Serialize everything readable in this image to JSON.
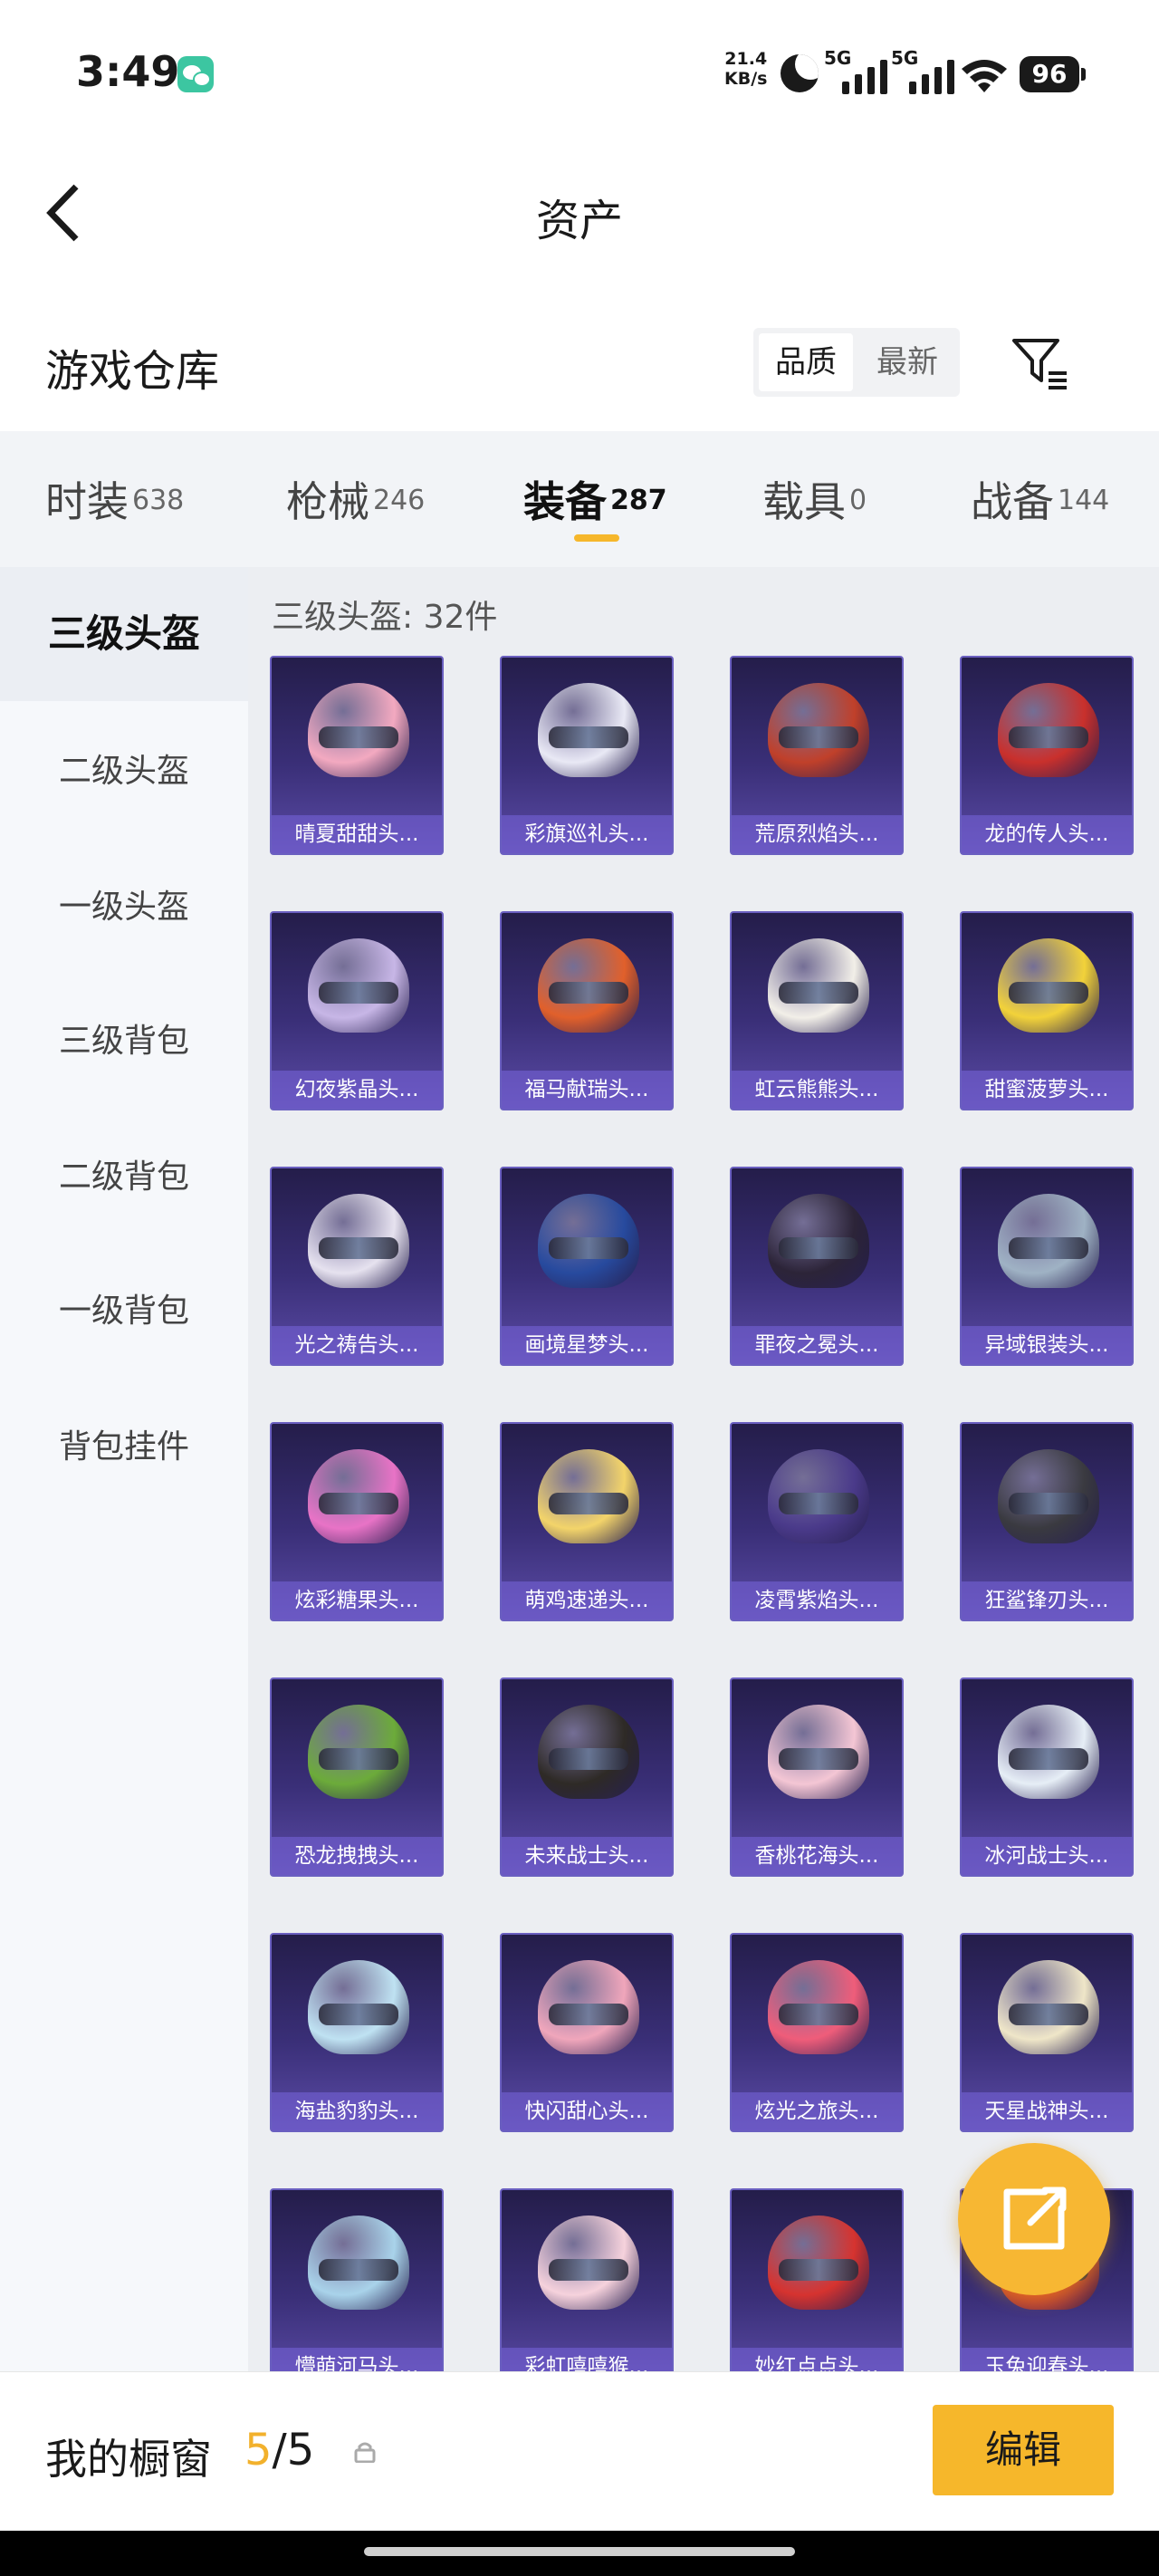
{
  "status": {
    "time": "3:49",
    "net_speed_value": "21.4",
    "net_speed_unit": "KB/s",
    "sim1": "5G",
    "sim2": "5G",
    "battery": "96"
  },
  "header": {
    "title": "资产"
  },
  "warehouse": {
    "title": "游戏仓库",
    "sort_options": [
      "品质",
      "最新"
    ],
    "sort_selected": "品质"
  },
  "tabs": [
    {
      "label": "时装",
      "count": "638"
    },
    {
      "label": "枪械",
      "count": "246"
    },
    {
      "label": "装备",
      "count": "287"
    },
    {
      "label": "载具",
      "count": "0"
    },
    {
      "label": "战备",
      "count": "144"
    }
  ],
  "active_tab": "装备",
  "sidenav": [
    {
      "label": "三级头盔"
    },
    {
      "label": "二级头盔"
    },
    {
      "label": "一级头盔"
    },
    {
      "label": "三级背包"
    },
    {
      "label": "二级背包"
    },
    {
      "label": "一级背包"
    },
    {
      "label": "背包挂件"
    }
  ],
  "grid": {
    "heading": "三级头盔: 32件",
    "items": [
      {
        "label": "晴夏甜甜头...",
        "color": "#f3a9c0"
      },
      {
        "label": "彩旗巡礼头...",
        "color": "#e9e9f5"
      },
      {
        "label": "荒原烈焰头...",
        "color": "#c0402a"
      },
      {
        "label": "龙的传人头...",
        "color": "#c9302c"
      },
      {
        "label": "幻夜紫晶头...",
        "color": "#c7b6e6"
      },
      {
        "label": "福马献瑞头...",
        "color": "#e1602b"
      },
      {
        "label": "虹云熊熊头...",
        "color": "#f2efe8"
      },
      {
        "label": "甜蜜菠萝头...",
        "color": "#f2d23a"
      },
      {
        "label": "光之祷告头...",
        "color": "#e6e2ef"
      },
      {
        "label": "画境星梦头...",
        "color": "#274a9e"
      },
      {
        "label": "罪夜之冕头...",
        "color": "#2c2438"
      },
      {
        "label": "异域银装头...",
        "color": "#9fb2c4"
      },
      {
        "label": "炫彩糖果头...",
        "color": "#e873c6"
      },
      {
        "label": "萌鸡速递头...",
        "color": "#f3d46a"
      },
      {
        "label": "凌霄紫焰头...",
        "color": "#4a3a8a"
      },
      {
        "label": "狂鲨锋刃头...",
        "color": "#3a3a40"
      },
      {
        "label": "恐龙拽拽头...",
        "color": "#6cab3a"
      },
      {
        "label": "未来战士头...",
        "color": "#2e2a26"
      },
      {
        "label": "香桃花海头...",
        "color": "#f4c6d4"
      },
      {
        "label": "冰河战士头...",
        "color": "#e6eef6"
      },
      {
        "label": "海盐豹豹头...",
        "color": "#bfe2f2"
      },
      {
        "label": "快闪甜心头...",
        "color": "#f0a6bb"
      },
      {
        "label": "炫光之旅头...",
        "color": "#ef5d7a"
      },
      {
        "label": "天星战神头...",
        "color": "#efe6c8"
      },
      {
        "label": "懵萌河马头...",
        "color": "#a9d3ea"
      },
      {
        "label": "彩虹嘻嘻猴...",
        "color": "#f6d2dc"
      },
      {
        "label": "妙红点点头...",
        "color": "#d6332f"
      },
      {
        "label": "玉兔迎春头...",
        "color": "#e24a2f"
      }
    ]
  },
  "bottom": {
    "my_window": "我的橱窗",
    "count_current": "5",
    "count_total": "/5",
    "edit_label": "编辑"
  }
}
